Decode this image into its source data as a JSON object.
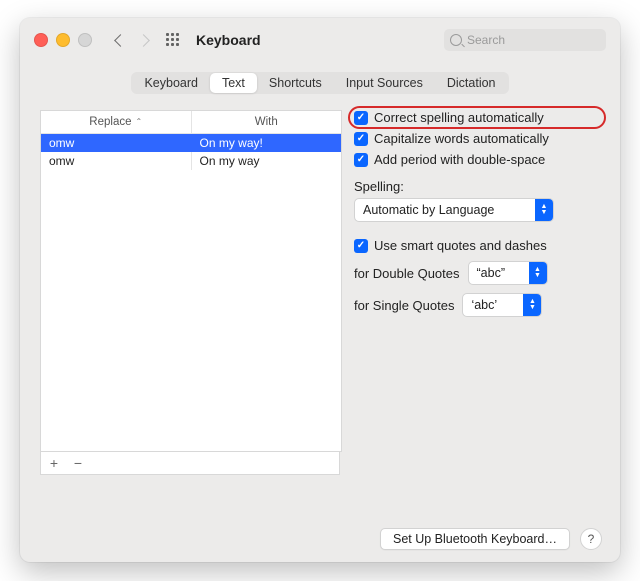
{
  "window": {
    "title": "Keyboard"
  },
  "search": {
    "placeholder": "Search"
  },
  "tabs": [
    "Keyboard",
    "Text",
    "Shortcuts",
    "Input Sources",
    "Dictation"
  ],
  "active_tab": "Text",
  "table": {
    "cols": [
      "Replace",
      "With"
    ],
    "rows": [
      {
        "replace": "omw",
        "with": "On my way!",
        "selected": true
      },
      {
        "replace": "omw",
        "with": "On my way"
      }
    ]
  },
  "footer": {
    "add": "+",
    "remove": "−"
  },
  "options": {
    "correct_spelling": "Correct spelling automatically",
    "capitalize": "Capitalize words automatically",
    "double_space": "Add period with double-space",
    "spelling_label": "Spelling:",
    "spelling_value": "Automatic by Language",
    "smart_quotes": "Use smart quotes and dashes",
    "double_quotes_label": "for Double Quotes",
    "double_quotes_value": "“abc”",
    "single_quotes_label": "for Single Quotes",
    "single_quotes_value": "‘abc’"
  },
  "bottom": {
    "bluetooth": "Set Up Bluetooth Keyboard…",
    "help": "?"
  }
}
